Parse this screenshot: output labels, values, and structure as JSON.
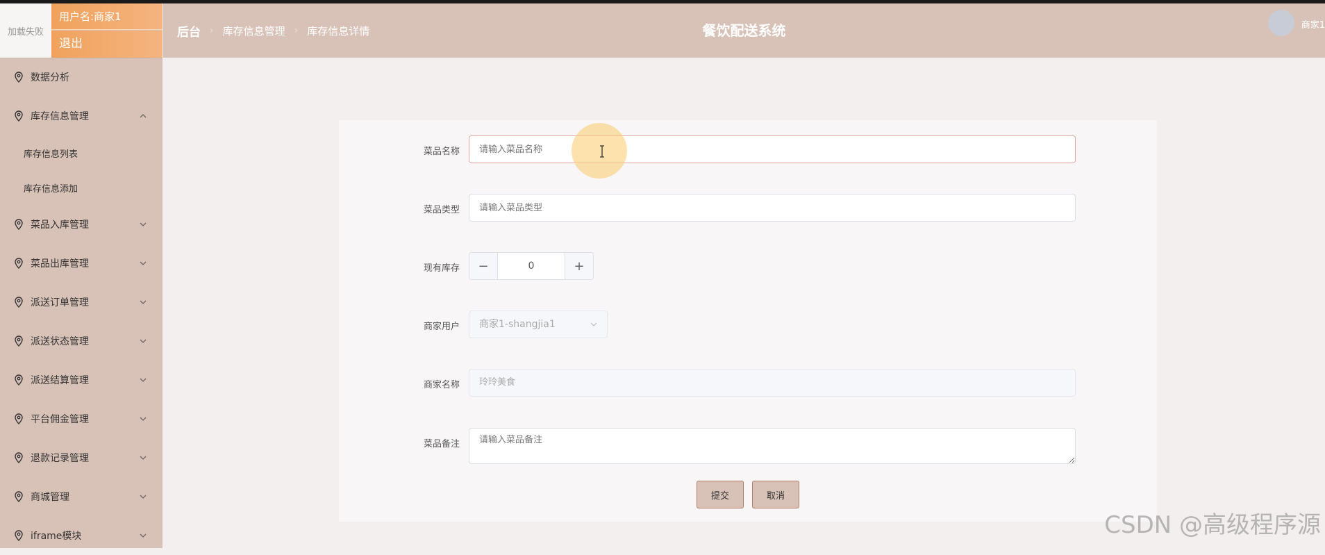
{
  "user": {
    "avatar_text": "加载失败",
    "username_label": "用户名:商家1",
    "logout_label": "退出"
  },
  "sidebar": {
    "items": [
      {
        "label": "数据分析"
      },
      {
        "label": "库存信息管理",
        "children": [
          {
            "label": "库存信息列表"
          },
          {
            "label": "库存信息添加"
          }
        ]
      },
      {
        "label": "菜品入库管理"
      },
      {
        "label": "菜品出库管理"
      },
      {
        "label": "派送订单管理"
      },
      {
        "label": "派送状态管理"
      },
      {
        "label": "派送结算管理"
      },
      {
        "label": "平台佣金管理"
      },
      {
        "label": "退款记录管理"
      },
      {
        "label": "商城管理"
      },
      {
        "label": "iframe模块"
      }
    ]
  },
  "header": {
    "breadcrumb": [
      "后台",
      "库存信息管理",
      "库存信息详情"
    ],
    "title": "餐饮配送系统",
    "user_name": "商家1"
  },
  "form": {
    "dish_name": {
      "label": "菜品名称",
      "placeholder": "请输入菜品名称",
      "value": ""
    },
    "dish_type": {
      "label": "菜品类型",
      "placeholder": "请输入菜品类型",
      "value": ""
    },
    "stock": {
      "label": "现有库存",
      "value": "0",
      "minus": "−",
      "plus": "+"
    },
    "merchant_user": {
      "label": "商家用户",
      "value": "商家1-shangjia1"
    },
    "merchant_name": {
      "label": "商家名称",
      "value": "玲玲美食"
    },
    "dish_note": {
      "label": "菜品备注",
      "placeholder": "请输入菜品备注",
      "value": ""
    },
    "submit_label": "提交",
    "cancel_label": "取消"
  },
  "watermark": "CSDN @高级程序源",
  "colors": {
    "theme": "#d8c2b8",
    "accent": "#f0a25c",
    "focus_border": "#e8a4a4"
  }
}
